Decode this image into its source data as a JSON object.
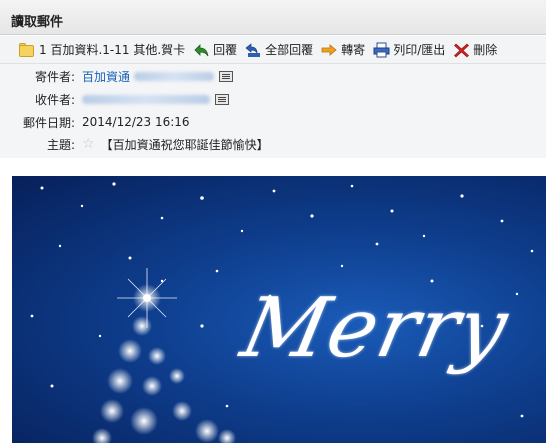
{
  "window": {
    "title": "讀取郵件"
  },
  "toolbar": {
    "folder_label": "1 百加資料.1-11 其他.賀卡",
    "reply_label": "回覆",
    "reply_all_label": "全部回覆",
    "forward_label": "轉寄",
    "print_label": "列印/匯出",
    "delete_label": "刪除"
  },
  "headers": {
    "from_label": "寄件者:",
    "from_name": "百加資通",
    "to_label": "收件者:",
    "date_label": "郵件日期:",
    "date_value": "2014/12/23 16:16",
    "subject_label": "主題:",
    "subject_value": "【百加資通祝您耶誕佳節愉快】"
  },
  "card": {
    "greeting": "Merry"
  },
  "colors": {
    "link": "#1a62b6",
    "card_blue": "#0e3d8c"
  }
}
